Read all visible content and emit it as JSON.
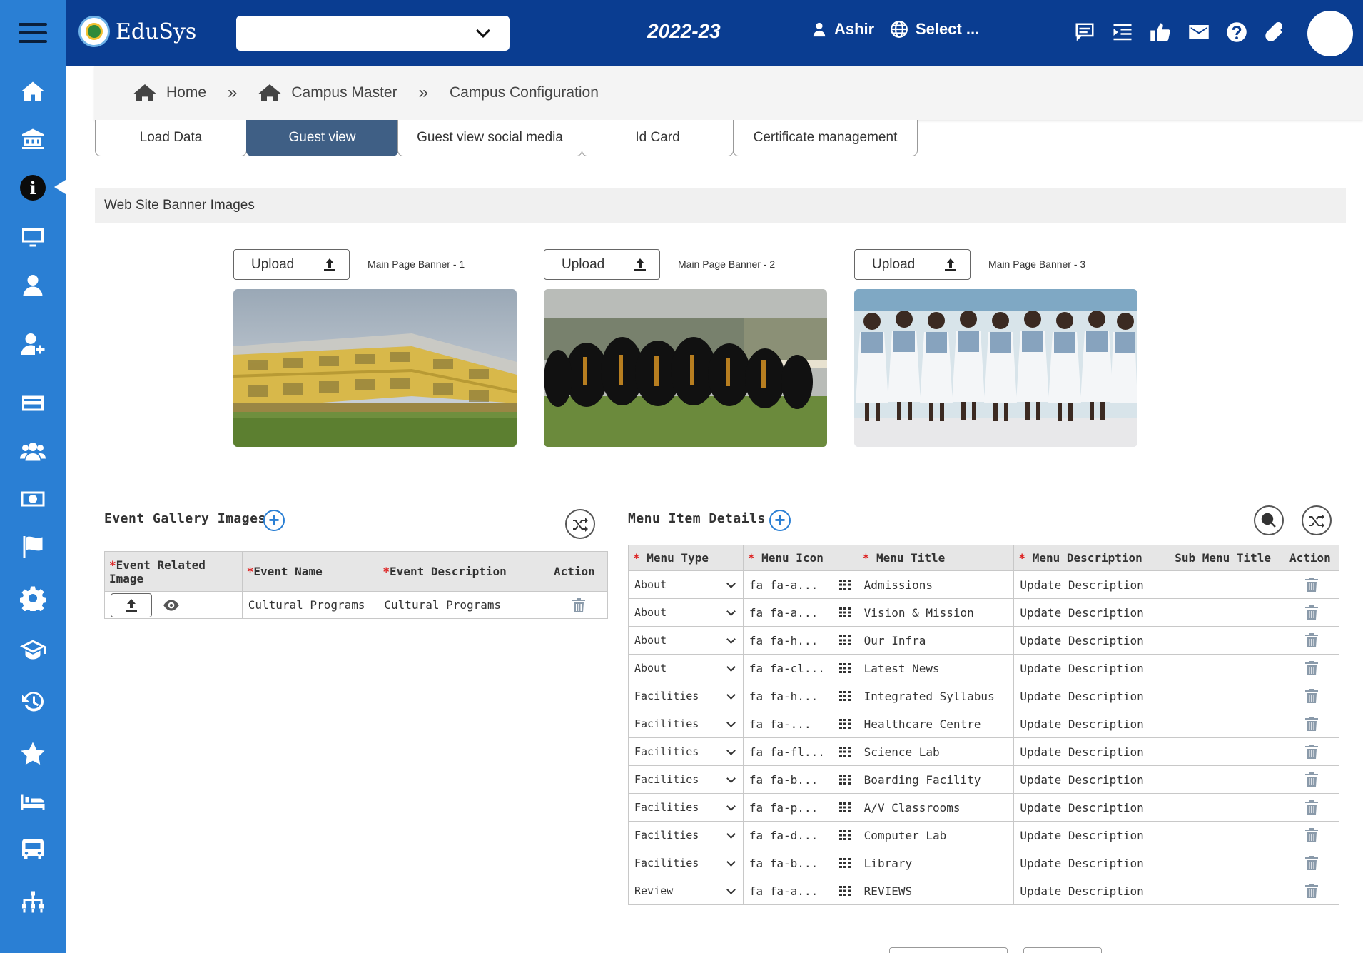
{
  "app": {
    "logo_text": "EduSys",
    "year": "2022-23",
    "user_name": "Ashir",
    "language": "Select ..."
  },
  "breadcrumb": {
    "home": "Home",
    "campus_master": "Campus Master",
    "current": "Campus Configuration"
  },
  "tabs": [
    {
      "label": "Load Data",
      "active": false
    },
    {
      "label": "Guest view",
      "active": true
    },
    {
      "label": "Guest view social media",
      "active": false
    },
    {
      "label": "Id Card",
      "active": false
    },
    {
      "label": "Certificate management",
      "active": false
    }
  ],
  "banner_section": {
    "title": "Web Site Banner Images",
    "banners": [
      {
        "upload_label": "Upload",
        "label": "Main Page Banner - 1"
      },
      {
        "upload_label": "Upload",
        "label": "Main Page Banner - 2"
      },
      {
        "upload_label": "Upload",
        "label": "Main Page Banner - 3"
      }
    ]
  },
  "event_gallery": {
    "title": "Event Gallery Images",
    "headers": [
      "Event Related Image",
      "Event Name",
      "Event Description",
      "Action"
    ],
    "rows": [
      {
        "name": "Cultural Programs",
        "description": "Cultural Programs"
      }
    ]
  },
  "menu_items": {
    "title": "Menu Item Details",
    "headers": [
      "Menu Type",
      "Menu Icon",
      "Menu Title",
      "Menu Description",
      "Sub Menu Title",
      "Action"
    ],
    "rows": [
      {
        "type": "About",
        "icon": "fa fa-a...",
        "title": "Admissions",
        "description": "Update Description",
        "sub": ""
      },
      {
        "type": "About",
        "icon": "fa fa-a...",
        "title": "Vision & Mission",
        "description": "Update Description",
        "sub": ""
      },
      {
        "type": "About",
        "icon": "fa fa-h...",
        "title": "Our Infra",
        "description": "Update Description",
        "sub": ""
      },
      {
        "type": "About",
        "icon": "fa fa-cl...",
        "title": "Latest News",
        "description": "Update Description",
        "sub": ""
      },
      {
        "type": "Facilities",
        "icon": "fa fa-h...",
        "title": "Integrated Syllabus",
        "description": "Update Description",
        "sub": ""
      },
      {
        "type": "Facilities",
        "icon": "fa fa-...",
        "title": "Healthcare Centre",
        "description": "Update Description",
        "sub": ""
      },
      {
        "type": "Facilities",
        "icon": "fa fa-fl...",
        "title": "Science Lab",
        "description": "Update Description",
        "sub": ""
      },
      {
        "type": "Facilities",
        "icon": "fa fa-b...",
        "title": "Boarding Facility",
        "description": "Update Description",
        "sub": ""
      },
      {
        "type": "Facilities",
        "icon": "fa fa-p...",
        "title": "A/V Classrooms",
        "description": "Update Description",
        "sub": ""
      },
      {
        "type": "Facilities",
        "icon": "fa fa-d...",
        "title": "Computer Lab",
        "description": "Update Description",
        "sub": ""
      },
      {
        "type": "Facilities",
        "icon": "fa fa-b...",
        "title": "Library",
        "description": "Update Description",
        "sub": ""
      },
      {
        "type": "Review",
        "icon": "fa fa-a...",
        "title": "REVIEWS",
        "description": "Update Description",
        "sub": ""
      }
    ]
  },
  "colors": {
    "sidebar": "#2a7fd4",
    "topbar": "#0a3d91",
    "active_tab": "#3f5f85",
    "required": "#dd2222"
  },
  "sidebar_icons": [
    "menu-icon",
    "home-icon",
    "institution-icon",
    "info-icon",
    "monitor-icon",
    "user-icon",
    "user-add-icon",
    "card-icon",
    "users-icon",
    "money-icon",
    "flag-icon",
    "gear-icon",
    "graduation-cap-icon",
    "history-icon",
    "star-icon",
    "bed-icon",
    "bus-icon",
    "sitemap-icon"
  ]
}
